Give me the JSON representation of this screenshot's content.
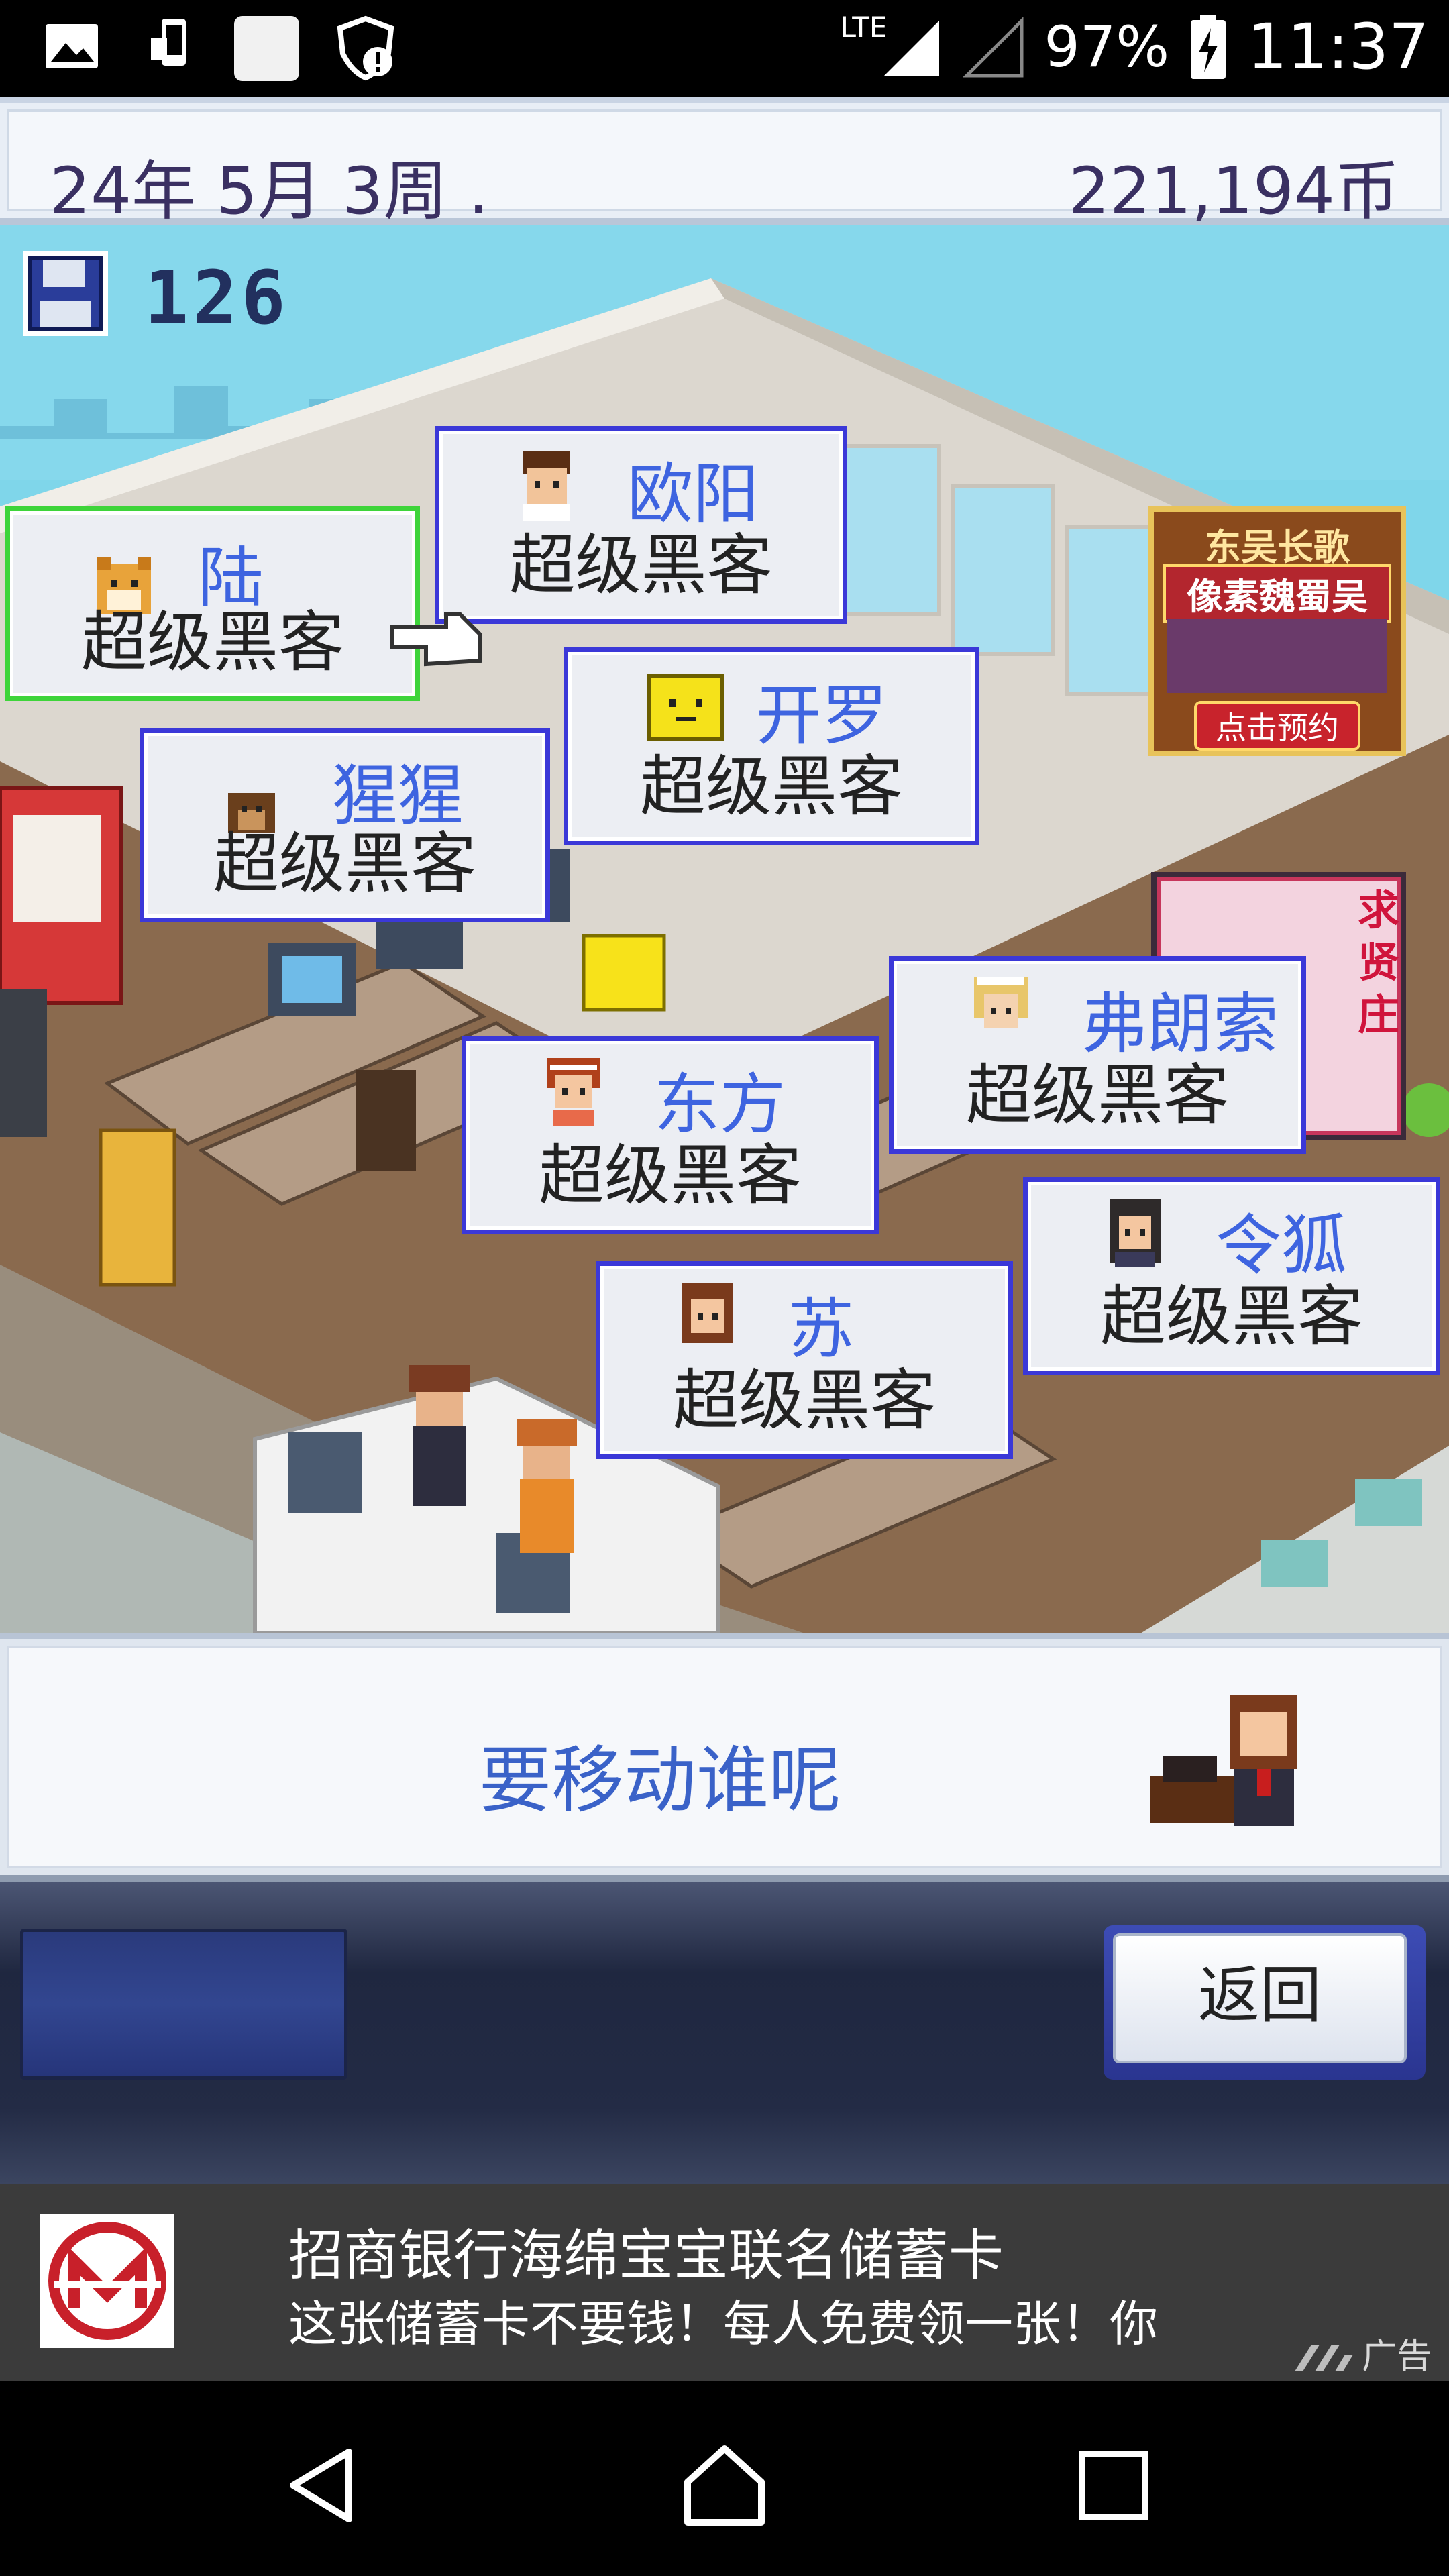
{
  "status_bar": {
    "network": "LTE",
    "battery": "97%",
    "time": "11:37"
  },
  "header": {
    "date": "24年 5月 3周 .",
    "money": "221,194币"
  },
  "save": {
    "count": "126"
  },
  "cards": [
    {
      "name": "陆",
      "role": "超级黑客",
      "active": true
    },
    {
      "name": "欧阳",
      "role": "超级黑客"
    },
    {
      "name": "猩猩",
      "role": "超级黑客"
    },
    {
      "name": "开罗",
      "role": "超级黑客"
    },
    {
      "name": "东方",
      "role": "超级黑客"
    },
    {
      "name": "弗朗索",
      "role": "超级黑客"
    },
    {
      "name": "苏",
      "role": "超级黑客"
    },
    {
      "name": "令狐",
      "role": "超级黑客"
    }
  ],
  "promo": {
    "line1": "东吴长歌",
    "line2": "像素魏蜀吴",
    "button": "点击预约"
  },
  "poster": {
    "text": "求贤庄"
  },
  "message": {
    "text": "要移动谁呢"
  },
  "controls": {
    "back_label": "返回"
  },
  "ad": {
    "title": "招商银行海绵宝宝联名储蓄卡",
    "desc": "这张储蓄卡不要钱！每人免费领一张！你",
    "tag": "广告"
  },
  "colors": {
    "card_border": "#3b38d8",
    "card_active_border": "#3ed43a",
    "name_text": "#3e64e0",
    "header_text": "#3a3062"
  }
}
